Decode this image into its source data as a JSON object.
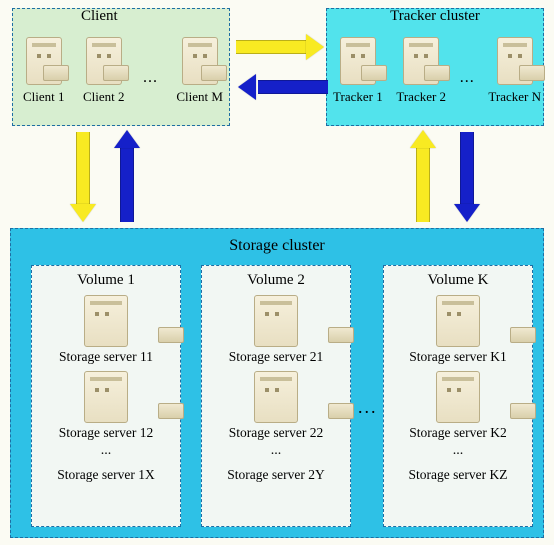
{
  "client": {
    "title": "Client",
    "items": [
      "Client 1",
      "Client 2",
      "Client M"
    ],
    "ellipsis": "..."
  },
  "tracker": {
    "title": "Tracker cluster",
    "items": [
      "Tracker 1",
      "Tracker 2",
      "Tracker N"
    ],
    "ellipsis": "..."
  },
  "storage": {
    "title": "Storage cluster",
    "ellipsis": "...",
    "volumes": [
      {
        "title": "Volume 1",
        "servers_top": "Storage server 11",
        "servers_mid": "Storage server 12",
        "dots": "...",
        "servers_last": "Storage server 1X"
      },
      {
        "title": "Volume 2",
        "servers_top": "Storage server 21",
        "servers_mid": "Storage server 22",
        "dots": "...",
        "servers_last": "Storage server 2Y"
      },
      {
        "title": "Volume K",
        "servers_top": "Storage server K1",
        "servers_mid": "Storage server K2",
        "dots": "...",
        "servers_last": "Storage server KZ"
      }
    ]
  }
}
